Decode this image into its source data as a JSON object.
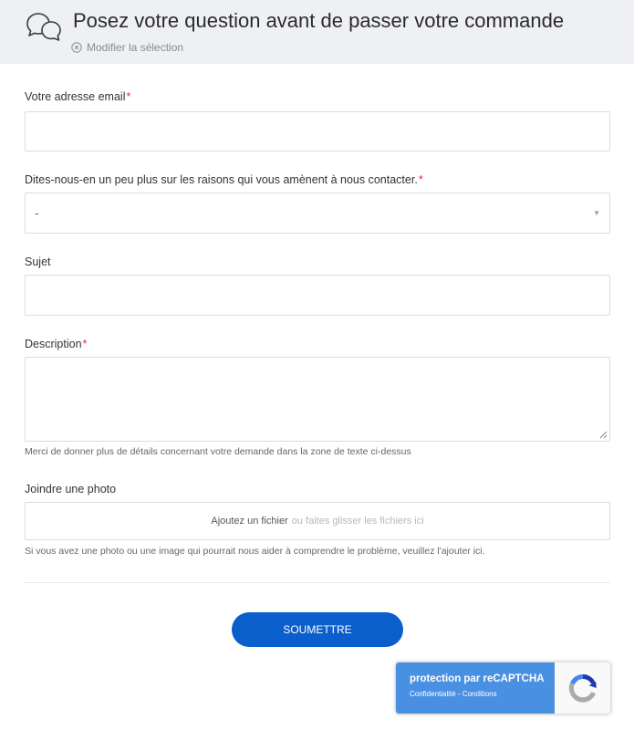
{
  "header": {
    "title": "Posez votre question avant de passer votre commande",
    "modify_label": "Modifier la sélection"
  },
  "form": {
    "email": {
      "label": "Votre adresse email",
      "required_mark": "*",
      "value": ""
    },
    "reason": {
      "label": "Dites-nous-en un peu plus sur les raisons qui vous amènent à nous contacter.",
      "required_mark": "*",
      "selected_value": "-"
    },
    "subject": {
      "label": "Sujet",
      "value": ""
    },
    "description": {
      "label": "Description",
      "required_mark": "*",
      "value": "",
      "hint": "Merci de donner plus de détails concernant votre demande dans la zone de texte ci-dessus"
    },
    "attachment": {
      "label": "Joindre une photo",
      "add_link": "Ajoutez un fichier",
      "drop_text": "ou faites glisser les fichiers ici",
      "hint": "Si vous avez une photo ou une image qui pourrait nous aider à comprendre le problème, veuillez l'ajouter ici."
    },
    "submit_label": "SOUMETTRE"
  },
  "recaptcha": {
    "title": "protection par reCAPTCHA",
    "privacy_label": "Confidentialité",
    "separator": " - ",
    "terms_label": "Conditions"
  },
  "colors": {
    "header_bg": "#eef0f3",
    "required": "#e0303a",
    "submit_bg": "#0b5fcc",
    "recaptcha_bg": "#4a90e2"
  }
}
